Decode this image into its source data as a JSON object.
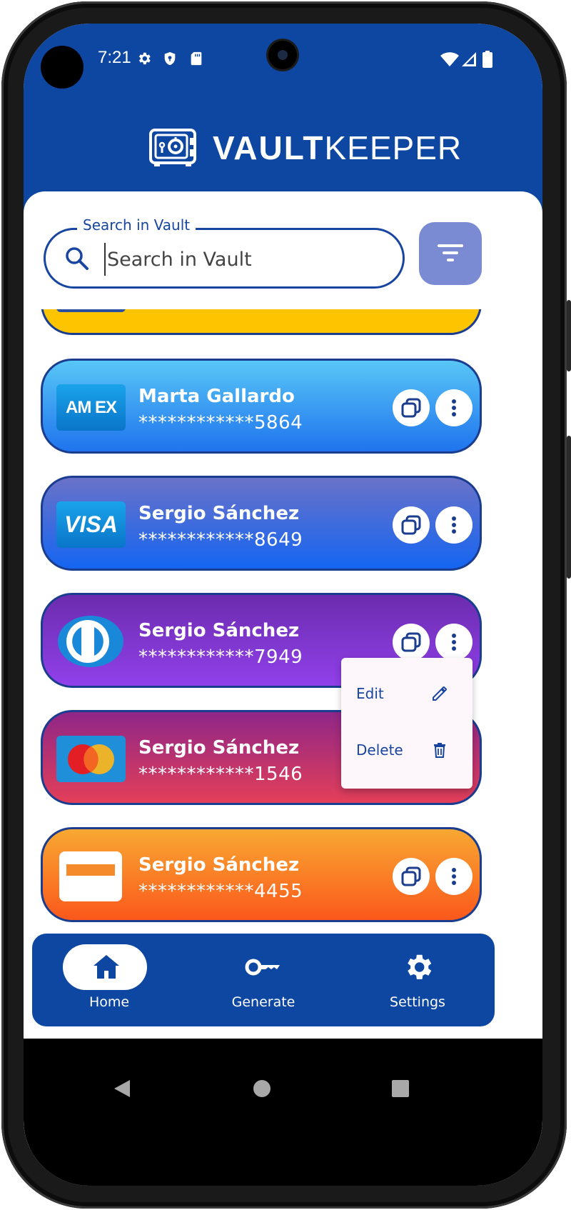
{
  "status_bar": {
    "time": "7:21"
  },
  "app": {
    "title_bold": "VAULT",
    "title_light": "KEEPER"
  },
  "search": {
    "label": "Search in Vault",
    "placeholder": "Search in Vault"
  },
  "cards": [
    {
      "holder": "Marta Gallardo",
      "number": "************5864",
      "brand": "AM EX",
      "brand_icon": "amex-logo",
      "gradient": [
        "#4fc3f7",
        "#1e6ff0"
      ]
    },
    {
      "holder": "Sergio Sánchez",
      "number": "************8649",
      "brand": "VISA",
      "brand_icon": "visa-logo",
      "gradient": [
        "#6b73c9",
        "#1463f0"
      ]
    },
    {
      "holder": "Sergio Sánchez",
      "number": "************7949",
      "brand": "",
      "brand_icon": "diners-club-logo",
      "gradient": [
        "#6d2bb0",
        "#8f3de8"
      ]
    },
    {
      "holder": "Sergio Sánchez",
      "number": "************1546",
      "brand": "",
      "brand_icon": "mastercard-logo",
      "gradient": [
        "#8e2585",
        "#e33f58"
      ]
    },
    {
      "holder": "Sergio Sánchez",
      "number": "************4455",
      "brand": "",
      "brand_icon": "generic-card-logo",
      "gradient": [
        "#f8a531",
        "#fb5a1c"
      ]
    }
  ],
  "context_menu": {
    "edit_label": "Edit",
    "delete_label": "Delete"
  },
  "bottom_nav": {
    "home": "Home",
    "generate": "Generate",
    "settings": "Settings"
  },
  "colors": {
    "primary": "#0d47a1",
    "accent": "#7a8bd4",
    "partial_card": "#ffc400"
  }
}
